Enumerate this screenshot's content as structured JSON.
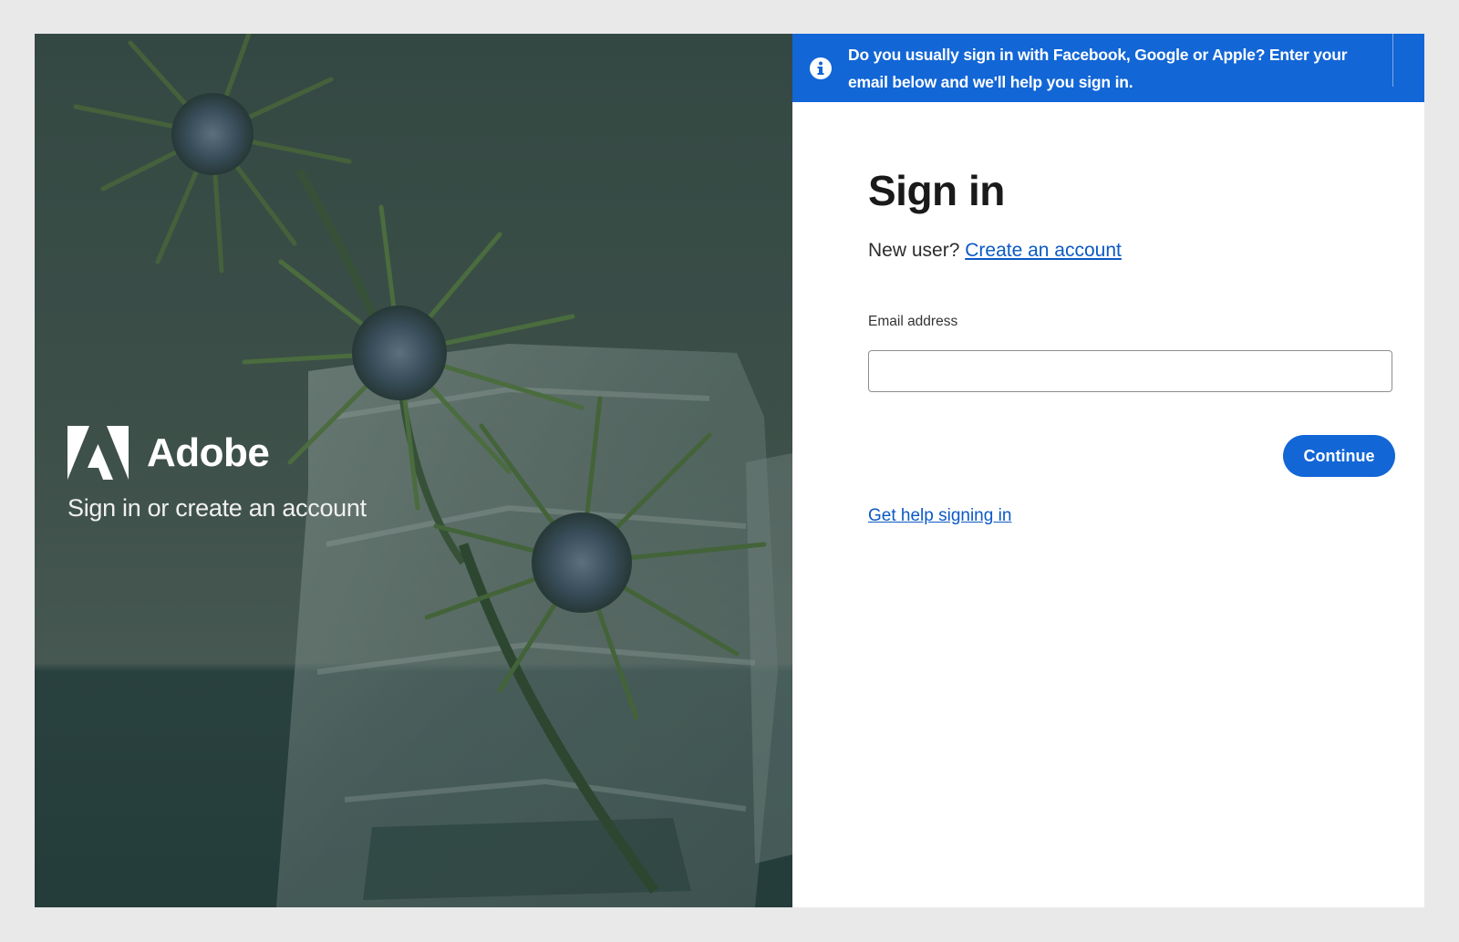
{
  "hero": {
    "brand_name": "Adobe",
    "tagline": "Sign in or create an account",
    "logo_icon": "adobe-logo-icon"
  },
  "banner": {
    "icon": "info-icon",
    "message": "Do you usually sign in with Facebook, Google or Apple? Enter your email below and we'll help you sign in.",
    "color": "#1266d6"
  },
  "form": {
    "title": "Sign in",
    "new_user_prompt": "New user?",
    "create_account_link": "Create an account",
    "email_label": "Email address",
    "email_value": "",
    "continue_label": "Continue",
    "help_link": "Get help signing in"
  },
  "colors": {
    "accent": "#1266d6",
    "link": "#0b59c6",
    "hero_background": "#44574f"
  }
}
